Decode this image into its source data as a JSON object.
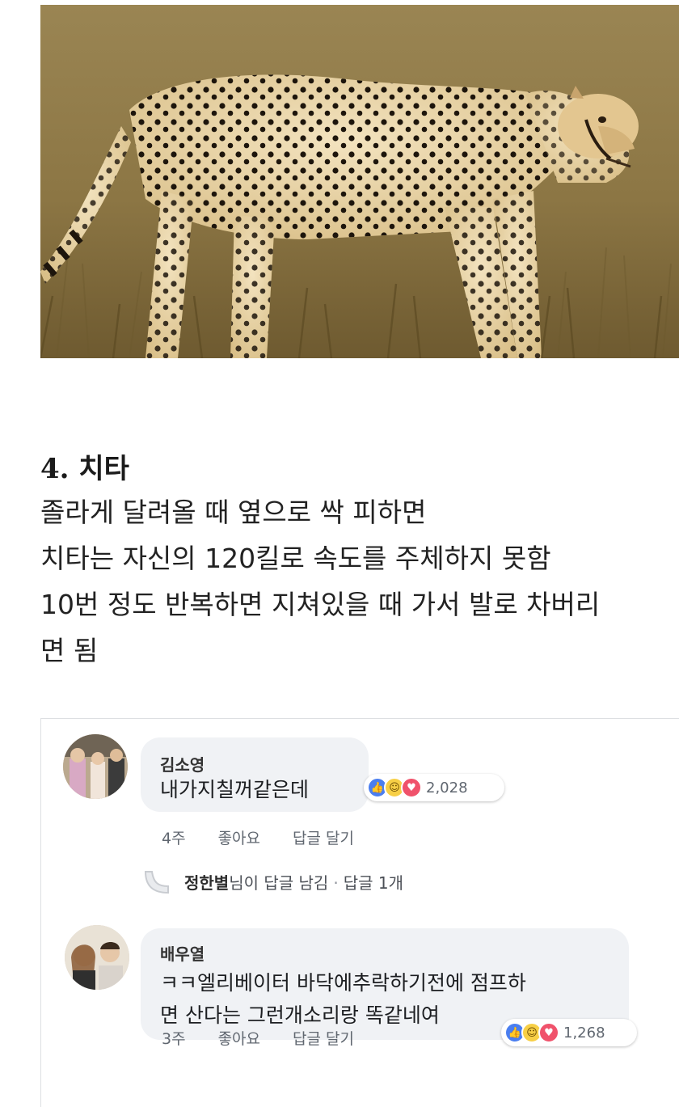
{
  "photo": {
    "subject": "cheetah-photo"
  },
  "article": {
    "heading": "4. 치타",
    "lines": [
      "졸라게 달려올 때 옆으로 싹 피하면",
      "치타는 자신의 120킬로 속도를 주체하지 못함",
      "10번 정도 반복하면 지쳐있을 때 가서 발로 차버리",
      "면 됨"
    ]
  },
  "comments": [
    {
      "author": "김소영",
      "text_lines": [
        "내가지칠꺼같은데"
      ],
      "reaction_count": "2,028",
      "time": "4주",
      "like_label": "좋아요",
      "reply_label": "답글 달기"
    },
    {
      "author": "배우열",
      "text_lines": [
        "ㅋㅋ엘리베이터 바닥에추락하기전에 점프하",
        "면 산다는 그런개소리랑 똑같네여"
      ],
      "reaction_count": "1,268",
      "time": "3주",
      "like_label": "좋아요",
      "reply_label": "답글 달기"
    }
  ],
  "reply_summary": {
    "name": "정한별",
    "suffix": "님이 답글 남김",
    "separator": "·",
    "count": "답글 1개"
  },
  "colors": {
    "like": "#4a7ef0",
    "haha": "#f7cf46",
    "love": "#f0526b",
    "bubble": "#f0f2f5",
    "meta": "#606770"
  }
}
